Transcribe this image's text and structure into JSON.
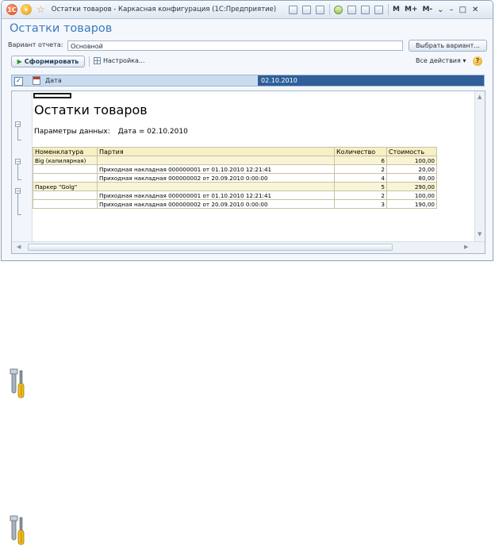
{
  "window": {
    "title": "Остатки товаров - Каркасная конфигурация (1С:Предприятие)",
    "toolbar_m": [
      "M",
      "M+",
      "M-"
    ]
  },
  "form": {
    "heading": "Остатки товаров",
    "variant_label": "Вариант отчета:",
    "variant_value": "Основной",
    "choose_variant": "Выбрать вариант...",
    "generate": "Сформировать",
    "settings": "Настройка...",
    "all_actions": "Все действия",
    "help": "?"
  },
  "params": {
    "checked": true,
    "name": "Дата",
    "value": "02.10.2010"
  },
  "report": {
    "title": "Остатки товаров",
    "params_label": "Параметры данных:",
    "params_value": "Дата = 02.10.2010",
    "columns": [
      "Номенклатура",
      "Партия",
      "Количество",
      "Стоимость"
    ],
    "rows": [
      {
        "group": true,
        "item": "Big (капилярная)",
        "batch": "",
        "qty": "6",
        "cost": "100,00"
      },
      {
        "group": false,
        "item": "",
        "batch": "Приходная накладная 000000001 от 01.10.2010 12:21:41",
        "qty": "2",
        "cost": "20,00"
      },
      {
        "group": false,
        "item": "",
        "batch": "Приходная накладная 000000002 от 20.09.2010 0:00:00",
        "qty": "4",
        "cost": "80,00"
      },
      {
        "group": true,
        "item": "Паркер \"Golg\"",
        "batch": "",
        "qty": "5",
        "cost": "290,00"
      },
      {
        "group": false,
        "item": "",
        "batch": "Приходная накладная 000000001 от 01.10.2010 12:21:41",
        "qty": "2",
        "cost": "100,00"
      },
      {
        "group": false,
        "item": "",
        "batch": "Приходная накладная 000000002 от 20.09.2010 0:00:00",
        "qty": "3",
        "cost": "190,00"
      }
    ]
  },
  "icons": [
    "tools-icon",
    "tools-icon"
  ]
}
